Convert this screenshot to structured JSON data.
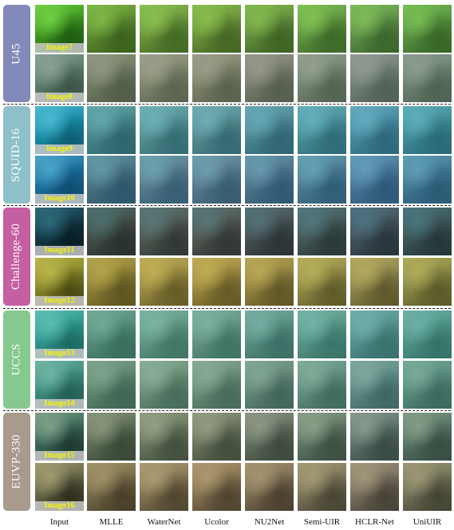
{
  "columns": [
    "Input",
    "MLLE",
    "WaterNet",
    "Ucolor",
    "NU2Net",
    "Semi-UIR",
    "HCLR-Net",
    "UniUIR"
  ],
  "groups": [
    {
      "name": "U45",
      "color": "#8389b9",
      "images": [
        {
          "label": "Image7",
          "palette": [
            "#3f9a22",
            "#6fcf42",
            "#1f5a10"
          ]
        },
        {
          "label": "Image8",
          "palette": [
            "#5d7f6e",
            "#8aa194",
            "#3c5546"
          ]
        }
      ]
    },
    {
      "name": "SQUID-16",
      "color": "#8ec0c9",
      "images": [
        {
          "label": "Image9",
          "palette": [
            "#1a8fab",
            "#48b8cf",
            "#0e5e73"
          ]
        },
        {
          "label": "Image10",
          "palette": [
            "#1d6fa0",
            "#4aa4c7",
            "#0f4d72"
          ]
        }
      ]
    },
    {
      "name": "Challenge-60",
      "color": "#c65ea2",
      "images": [
        {
          "label": "Image11",
          "palette": [
            "#123a45",
            "#2d6a7a",
            "#081e25"
          ]
        },
        {
          "label": "Image12",
          "palette": [
            "#8a8a2a",
            "#b9b54a",
            "#4a4a12"
          ]
        }
      ]
    },
    {
      "name": "UCCS",
      "color": "#86c98f",
      "images": [
        {
          "label": "Image13",
          "palette": [
            "#2f9a90",
            "#5bbdb2",
            "#1c6a62"
          ]
        },
        {
          "label": "Image14",
          "palette": [
            "#3e8f80",
            "#6fb3a3",
            "#255e54"
          ]
        }
      ]
    },
    {
      "name": "EUVP-330",
      "color": "#a89a8c",
      "images": [
        {
          "label": "Image15",
          "palette": [
            "#3c6a5a",
            "#7fa08a",
            "#1e3a30"
          ]
        },
        {
          "label": "Image16",
          "palette": [
            "#6a6a4a",
            "#a09a70",
            "#2e2e1e"
          ]
        }
      ]
    }
  ],
  "method_tints": [
    "#000000",
    "#a07a50",
    "#c89a70",
    "#c8906a",
    "#b08070",
    "#a89880",
    "#a08890",
    "#909080"
  ]
}
